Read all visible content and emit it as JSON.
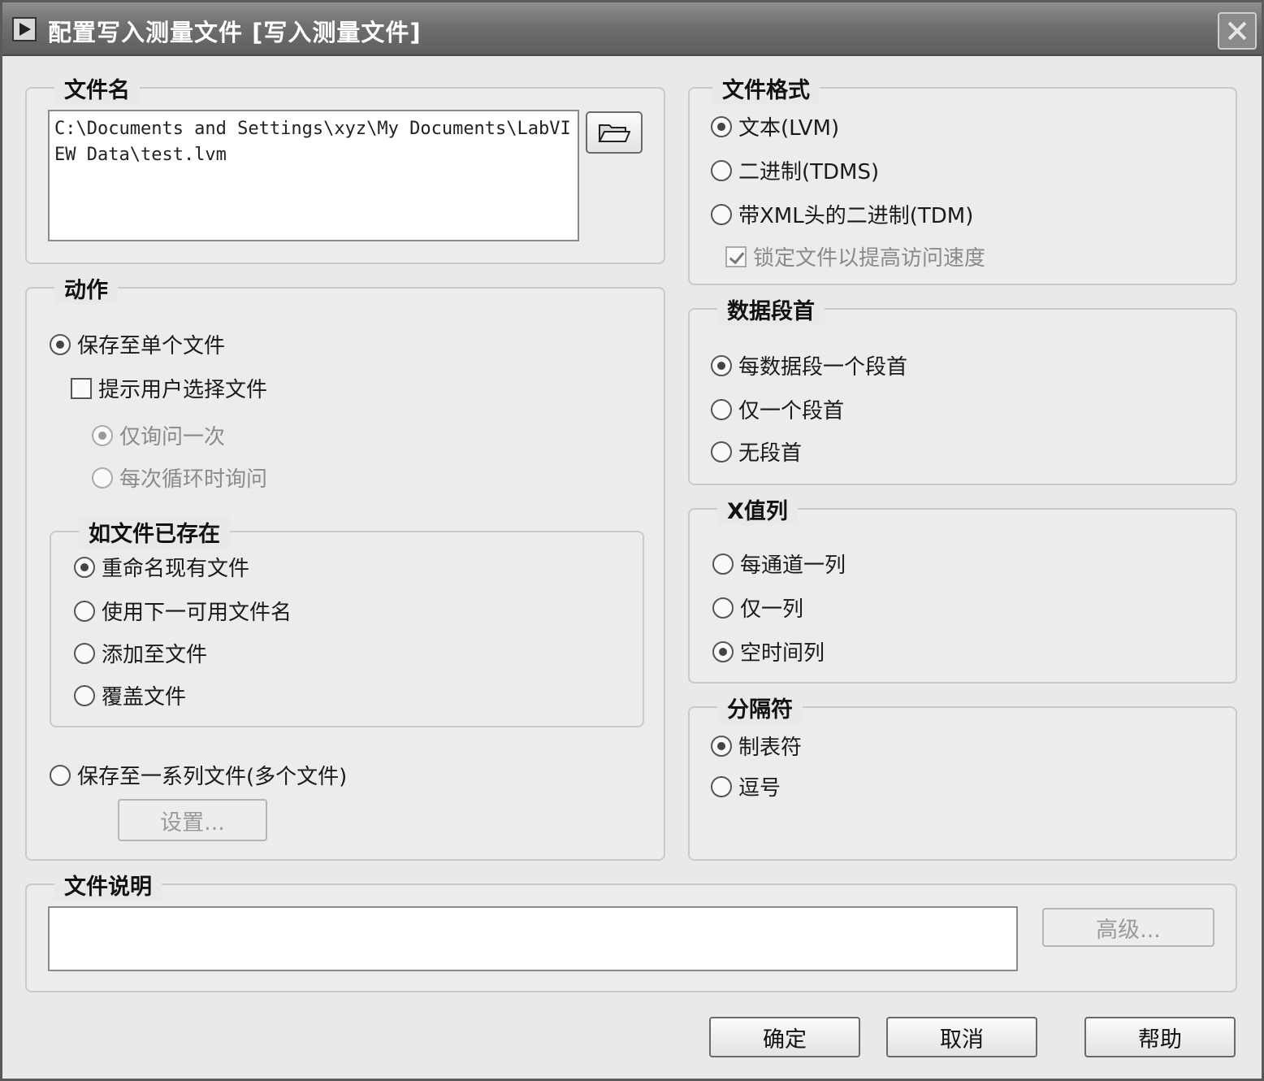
{
  "window": {
    "title": "配置写入测量文件 [写入测量文件]"
  },
  "filename": {
    "legend": "文件名",
    "path": "C:\\Documents and Settings\\xyz\\My Documents\\LabVIEW Data\\test.lvm"
  },
  "action": {
    "legend": "动作",
    "save_single": "保存至单个文件",
    "prompt_user": "提示用户选择文件",
    "ask_once": "仅询问一次",
    "ask_each_loop": "每次循环时询问",
    "if_exists": {
      "legend": "如文件已存在",
      "rename": "重命名现有文件",
      "next_name": "使用下一可用文件名",
      "append": "添加至文件",
      "overwrite": "覆盖文件"
    },
    "save_series": "保存至一系列文件(多个文件)",
    "settings_button": "设置..."
  },
  "file_format": {
    "legend": "文件格式",
    "text": "文本(LVM)",
    "binary": "二进制(TDMS)",
    "binary_xml": "带XML头的二进制(TDM)",
    "lock_file": "锁定文件以提高访问速度"
  },
  "segment_header": {
    "legend": "数据段首",
    "each": "每数据段一个段首",
    "one": "仅一个段首",
    "none": "无段首"
  },
  "x_column": {
    "legend": "X值列",
    "per_channel": "每通道一列",
    "one": "仅一列",
    "empty_time": "空时间列"
  },
  "delimiter": {
    "legend": "分隔符",
    "tab": "制表符",
    "comma": "逗号"
  },
  "description": {
    "legend": "文件说明",
    "value": "",
    "advanced_button": "高级..."
  },
  "footer": {
    "ok": "确定",
    "cancel": "取消",
    "help": "帮助"
  }
}
